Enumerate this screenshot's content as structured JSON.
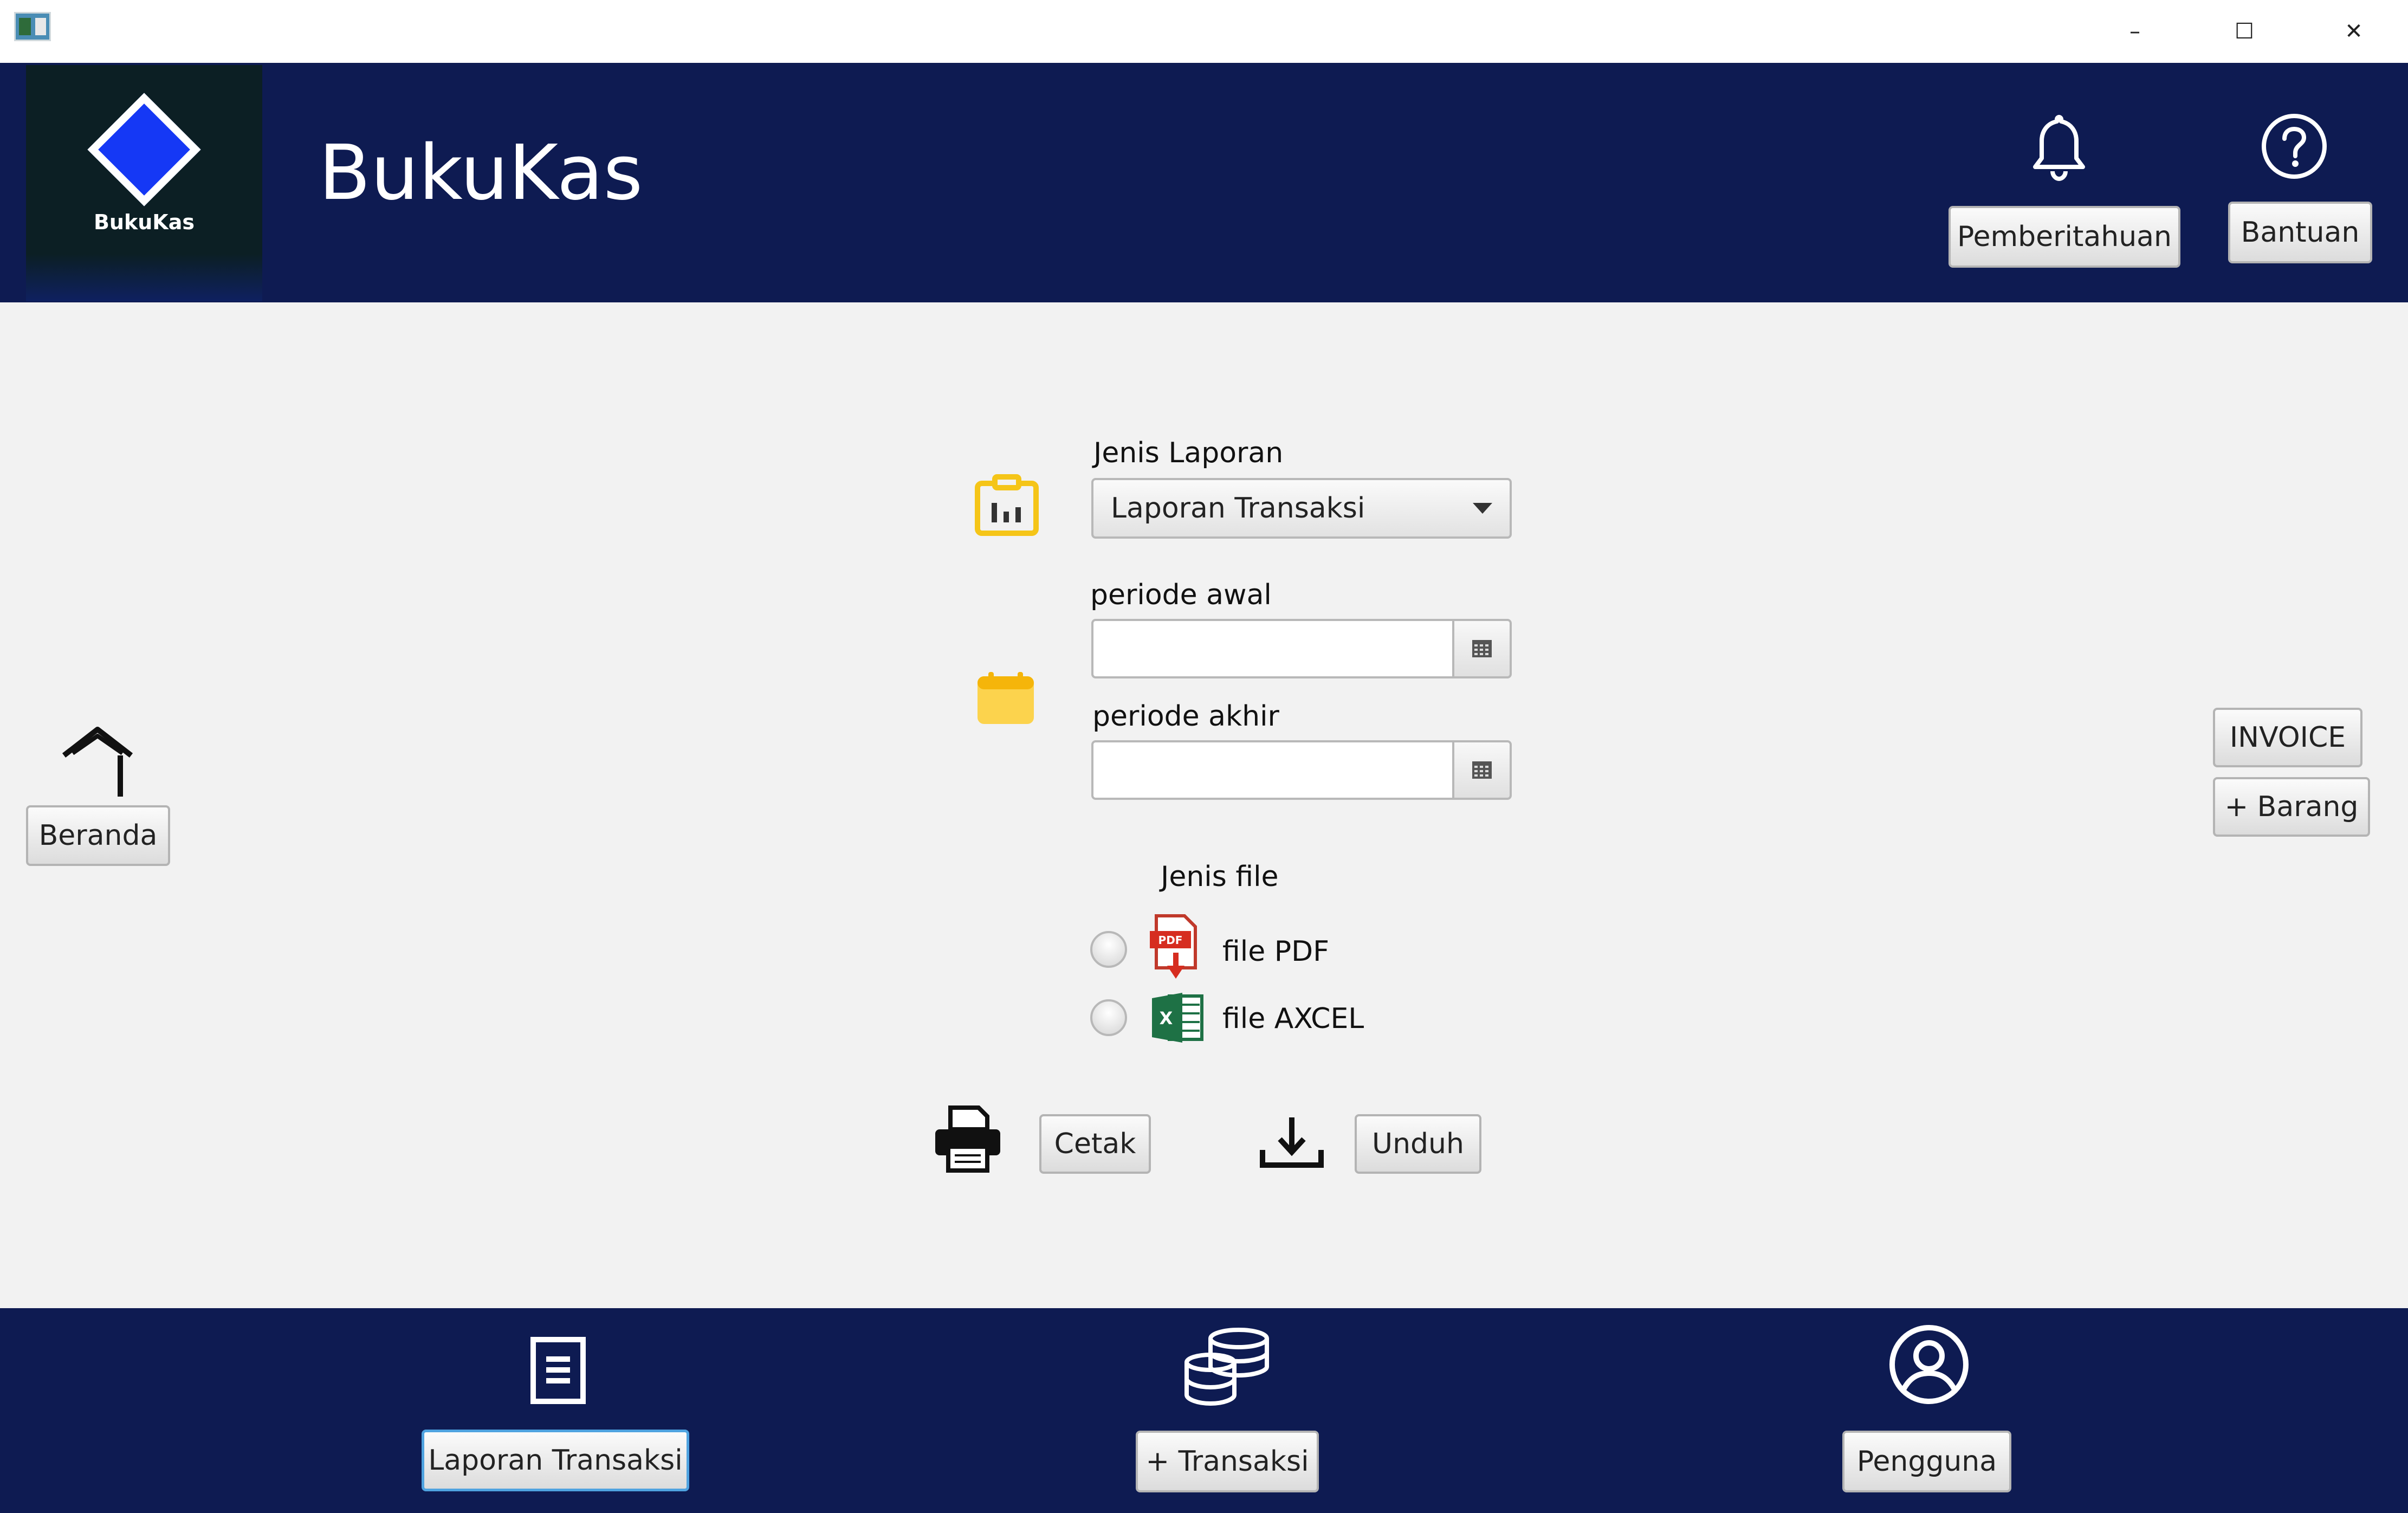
{
  "window": {
    "minimize_glyph": "–",
    "maximize_glyph": "☐",
    "close_glyph": "✕"
  },
  "header": {
    "logo_text": "BukuKas",
    "title": "BukuKas",
    "notification_label": "Pemberitahuan",
    "help_label": "Bantuan",
    "notification_icon": "bell-icon",
    "help_icon": "question-circle-icon"
  },
  "nav": {
    "home_label": "Beranda",
    "home_icon": "house-icon",
    "invoice_label": "INVOICE",
    "add_item_label": "+ Barang"
  },
  "form": {
    "report_type_label": "Jenis Laporan",
    "report_type_value": "Laporan Transaksi",
    "period_start_label": "periode awal",
    "period_start_value": "",
    "period_end_label": "periode akhir",
    "period_end_value": "",
    "file_type_label": "Jenis file",
    "file_options": [
      {
        "label": "file  PDF",
        "icon": "pdf-icon",
        "selected": false
      },
      {
        "label": "file AXCEL",
        "icon": "excel-icon",
        "selected": false
      }
    ],
    "print_label": "Cetak",
    "download_label": "Unduh",
    "print_icon": "printer-icon",
    "download_icon": "download-icon"
  },
  "footer": {
    "items": [
      {
        "label": "Laporan Transaksi",
        "icon": "document-icon",
        "active": true
      },
      {
        "label": "+ Transaksi",
        "icon": "database-icon",
        "active": false
      },
      {
        "label": "Pengguna",
        "icon": "user-circle-icon",
        "active": false
      }
    ]
  },
  "colors": {
    "header_bg": "#0e1b52",
    "body_bg": "#f2f2f2",
    "logo_diamond": "#1538f5",
    "accent_yellow": "#f5c518",
    "active_border": "#4fa3e0"
  }
}
